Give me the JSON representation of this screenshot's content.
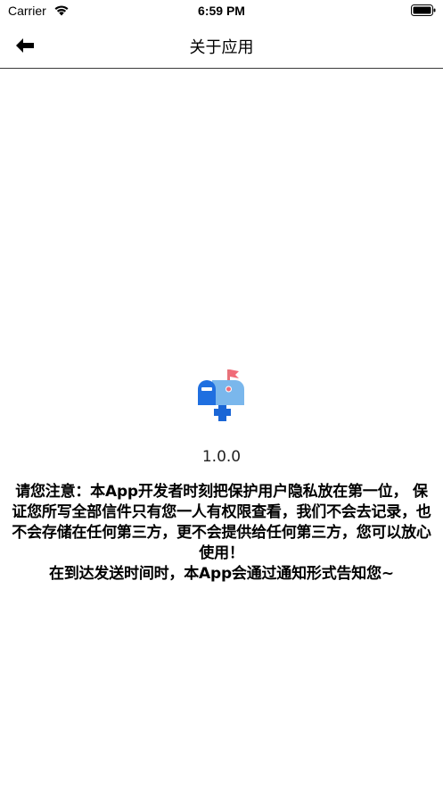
{
  "status_bar": {
    "carrier": "Carrier",
    "time": "6:59 PM"
  },
  "nav": {
    "title": "关于应用"
  },
  "about": {
    "version": "1.0.0",
    "notice": "请您注意：本App开发者时刻把保护用户隐私放在第一位， 保证您所写全部信件只有您一人有权限查看，我们不会去记录，也不会存储在任何第三方，更不会提供给任何第三方，您可以放心使用！\n 在到达发送时间时，本App会通过通知形式告知您~"
  },
  "icons": {
    "back": "back-arrow-icon",
    "app": "mailbox-icon",
    "wifi": "wifi-icon",
    "battery": "battery-icon"
  }
}
